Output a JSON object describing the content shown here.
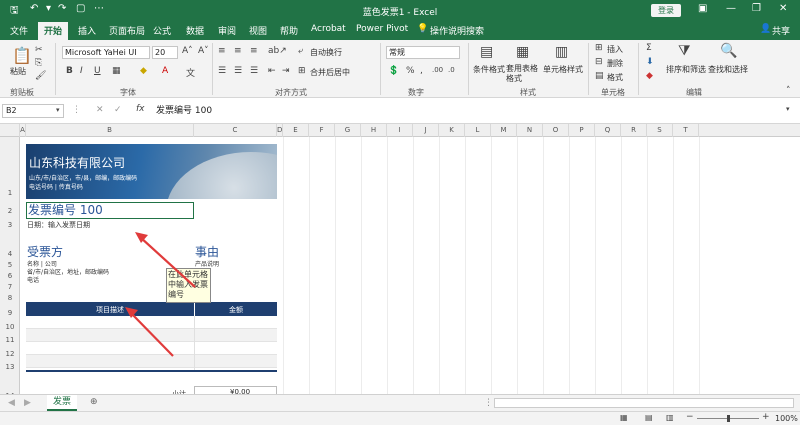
{
  "window": {
    "title": "蓝色发票1 - Excel",
    "login_label": "登录"
  },
  "tabs": [
    "文件",
    "开始",
    "插入",
    "页面布局",
    "公式",
    "数据",
    "审阅",
    "视图",
    "帮助",
    "Acrobat",
    "Power Pivot",
    "操作说明搜索",
    "共享"
  ],
  "ribbon": {
    "clipboard": {
      "paste": "粘贴",
      "label": "剪贴板"
    },
    "font": {
      "name": "Microsoft YaHei UI",
      "size": "20",
      "bold": "B",
      "italic": "I",
      "underline": "U",
      "label": "字体"
    },
    "alignment": {
      "wrap": "自动换行",
      "merge": "合并后居中",
      "label": "对齐方式"
    },
    "number": {
      "format": "常规",
      "label": "数字"
    },
    "styles": {
      "conditional": "条件格式",
      "table": "套用表格格式",
      "cell": "单元格样式",
      "label": "样式"
    },
    "cells": {
      "insert": "插入",
      "delete": "删除",
      "format": "格式",
      "label": "单元格"
    },
    "editing": {
      "sort": "排序和筛选",
      "find": "查找和选择",
      "label": "编辑"
    }
  },
  "formula_bar": {
    "name_box": "B2",
    "fx": "fx",
    "value": "发票编号 100"
  },
  "columns": [
    "A",
    "B",
    "C",
    "D",
    "E",
    "F",
    "G",
    "H",
    "I",
    "J",
    "K",
    "L",
    "M",
    "N",
    "O",
    "P",
    "Q",
    "R",
    "S",
    "T"
  ],
  "rows": [
    "1",
    "2",
    "3",
    "4",
    "5",
    "6",
    "7",
    "8",
    "9",
    "10",
    "11",
    "12",
    "13",
    "14"
  ],
  "invoice": {
    "company": "山东科技有限公司",
    "address_line": "山东/市/自治区，市/县，邮编，邮政编码",
    "contact_line": "电话号码 | 传真号码",
    "number": "发票编号 100",
    "date_line": "日期：输入发票日期",
    "bill_to_heading": "受票方",
    "bill_to_name": "名称 | 公司",
    "bill_to_address": "省/市/自治区，地址，邮政编码",
    "bill_to_phone": "电话",
    "reason_heading": "事由",
    "reason_desc": "产品说明",
    "col_desc": "项目描述",
    "col_amount": "金额",
    "subtotal_label": "小计",
    "subtotal_value": "¥0.00"
  },
  "tooltip": "在此单元格中输入发票编号",
  "sheet_tabs": [
    "发票"
  ],
  "status": {
    "zoom": "100%"
  }
}
